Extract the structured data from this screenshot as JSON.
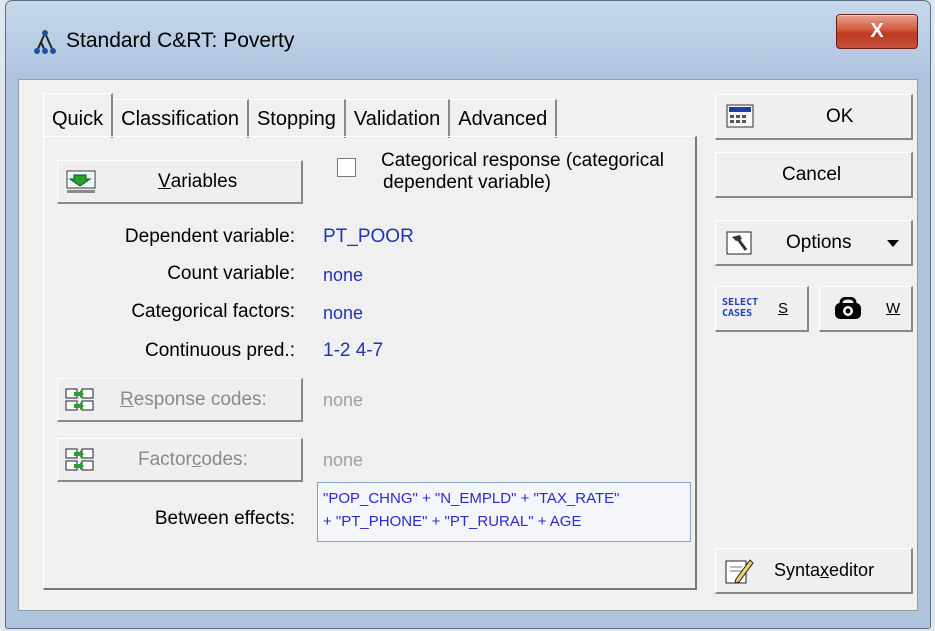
{
  "window": {
    "title": "Standard C&RT: Poverty",
    "close_label": "X"
  },
  "tabs": [
    {
      "label": "Quick"
    },
    {
      "label": "Classification"
    },
    {
      "label": "Stopping"
    },
    {
      "label": "Validation"
    },
    {
      "label": "Advanced"
    }
  ],
  "quick": {
    "variables_btn": {
      "pre": "",
      "accel": "V",
      "post": "ariables"
    },
    "categorical_checkbox": {
      "checked": false,
      "line1": "Categorical response (categorical",
      "line2": "dependent variable)"
    },
    "dependent": {
      "label": "Dependent variable:",
      "value": "PT_POOR"
    },
    "count": {
      "label": "Count variable:",
      "value": "none"
    },
    "cat_factors": {
      "label": "Categorical factors:",
      "value": "none"
    },
    "cont_pred": {
      "label": "Continuous pred.:",
      "value": "1-2 4-7"
    },
    "response_codes_btn": {
      "pre": "",
      "accel": "R",
      "post": "esponse codes:",
      "value": "none"
    },
    "factor_codes_btn": {
      "pre": "Factor ",
      "accel": "c",
      "post": "odes:",
      "value": "none"
    },
    "between": {
      "label": "Between effects:",
      "line1": "\"POP_CHNG\" + \"N_EMPLD\" + \"TAX_RATE\"",
      "line2": "+ \"PT_PHONE\" + \"PT_RURAL\" + AGE"
    }
  },
  "side": {
    "ok": "OK",
    "cancel": "Cancel",
    "options": "Options",
    "select_cases_icon_text": [
      "SELECT",
      "CASES"
    ],
    "s_label": "S",
    "w_label": "W",
    "syntax_editor": {
      "pre": "Synta",
      "accel": "x",
      "post": " editor"
    }
  },
  "colors": {
    "value_blue": "#2233b8",
    "effects_blue": "#2a2ad0",
    "disabled_gray": "#a0a0a0",
    "close_red": "#c7503a"
  }
}
